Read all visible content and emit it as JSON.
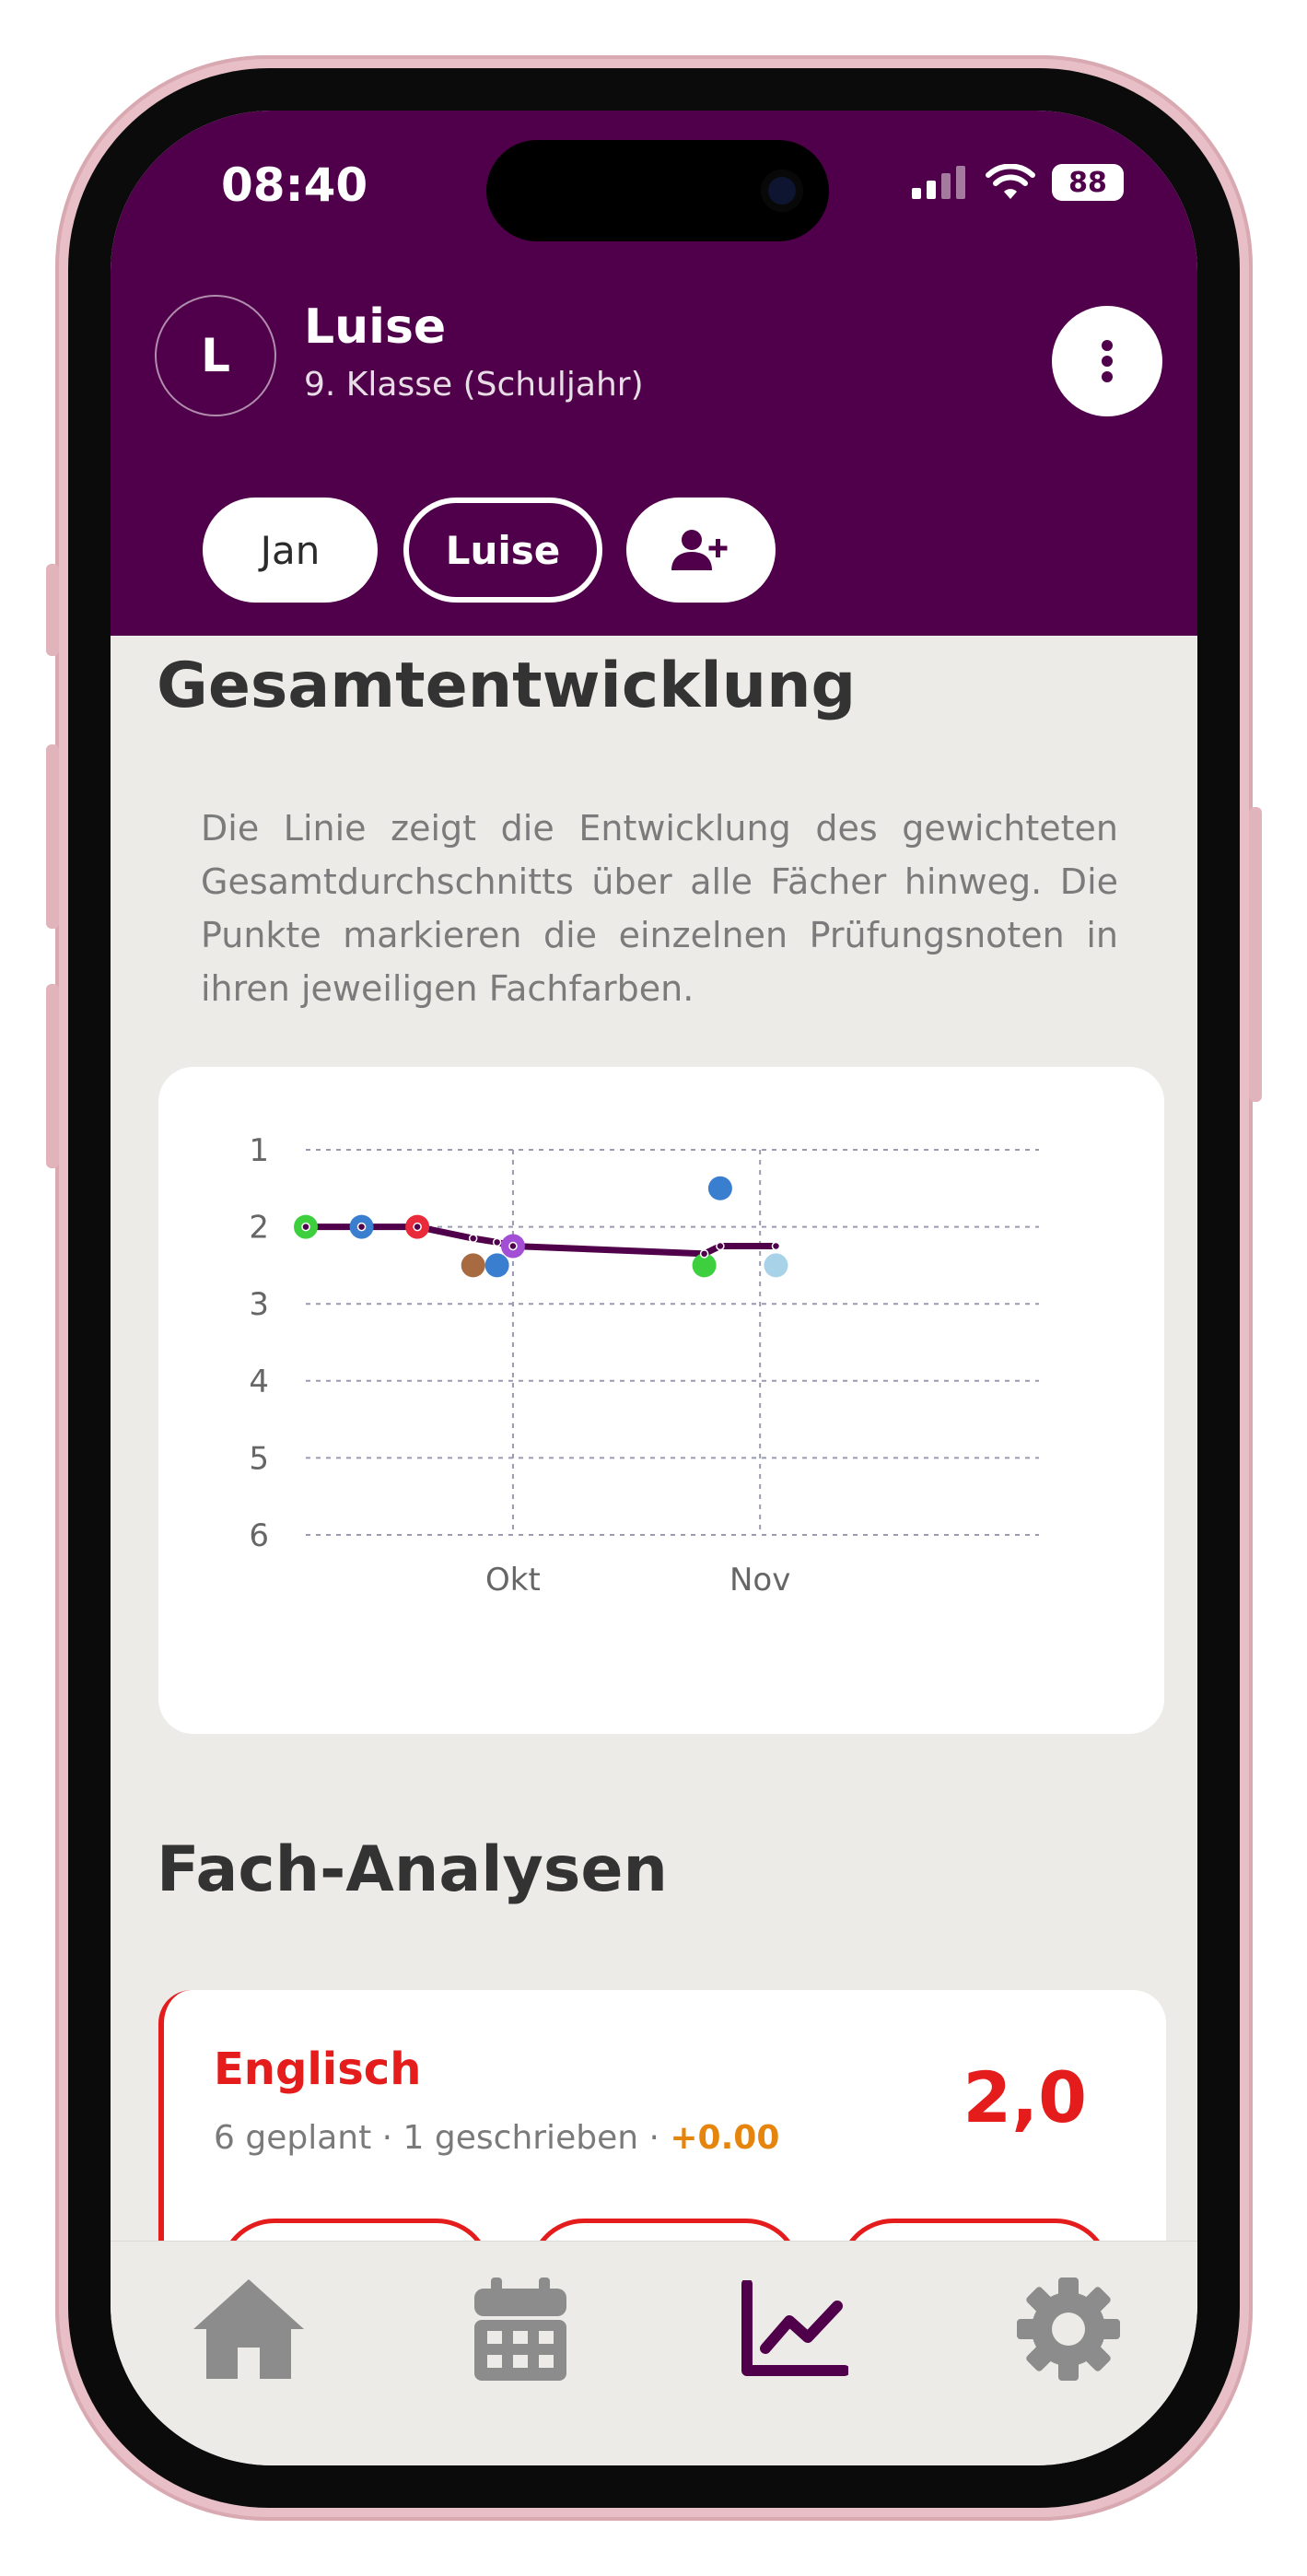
{
  "status_bar": {
    "time": "08:40",
    "battery": "88"
  },
  "profile": {
    "initial": "L",
    "name": "Luise",
    "class_label": "9. Klasse (Schuljahr)"
  },
  "students": [
    {
      "label": "Jan",
      "selected": false
    },
    {
      "label": "Luise",
      "selected": true
    }
  ],
  "overview": {
    "title": "Gesamtentwicklung",
    "description": "Die Linie zeigt die Entwicklung des gewichteten Gesamtdurchschnitts über alle Fächer hinweg. Die Punkte markieren die einzelnen Prüfungsnoten in ihren jeweiligen Fachfarben."
  },
  "chart_data": {
    "type": "line",
    "y_ticks": [
      "1",
      "2",
      "3",
      "4",
      "5",
      "6"
    ],
    "ylim": [
      1,
      6
    ],
    "y_inverted": true,
    "x_ticks": [
      "Okt",
      "Nov"
    ],
    "grid": true,
    "average_line": {
      "color": "#50004a",
      "points": [
        {
          "x": "2024-09-05",
          "y": 2.0
        },
        {
          "x": "2024-09-12",
          "y": 2.0
        },
        {
          "x": "2024-09-19",
          "y": 2.0
        },
        {
          "x": "2024-09-26",
          "y": 2.15
        },
        {
          "x": "2024-09-29",
          "y": 2.2
        },
        {
          "x": "2024-10-01",
          "y": 2.25
        },
        {
          "x": "2024-10-25",
          "y": 2.35
        },
        {
          "x": "2024-10-27",
          "y": 2.25
        },
        {
          "x": "2024-11-03",
          "y": 2.25
        }
      ]
    },
    "grade_points": [
      {
        "x": "2024-09-05",
        "y": 2.0,
        "color": "#3ecf3e"
      },
      {
        "x": "2024-09-12",
        "y": 2.0,
        "color": "#3a7ed0"
      },
      {
        "x": "2024-09-19",
        "y": 2.0,
        "color": "#e82a3a"
      },
      {
        "x": "2024-09-26",
        "y": 2.5,
        "color": "#a86a40"
      },
      {
        "x": "2024-09-29",
        "y": 2.5,
        "color": "#3a7ed0"
      },
      {
        "x": "2024-10-01",
        "y": 2.25,
        "color": "#a24fd6"
      },
      {
        "x": "2024-10-25",
        "y": 2.5,
        "color": "#3ecf3e"
      },
      {
        "x": "2024-10-27",
        "y": 1.5,
        "color": "#3a7ed0"
      },
      {
        "x": "2024-11-03",
        "y": 2.5,
        "color": "#a8d2e8"
      }
    ]
  },
  "analyses": {
    "title": "Fach-Analysen",
    "subjects": [
      {
        "name": "Englisch",
        "planned": "6 geplant",
        "written": "1 geschrieben",
        "separator": " · ",
        "trend": "+0.00",
        "grade": "2,0",
        "color": "#e51c1c"
      }
    ]
  },
  "nav": {
    "items": [
      {
        "icon": "home-icon",
        "active": false
      },
      {
        "icon": "calendar-icon",
        "active": false
      },
      {
        "icon": "chart-icon",
        "active": true
      },
      {
        "icon": "gear-icon",
        "active": false
      }
    ],
    "inactive_color": "#8c8c8c",
    "active_color": "#50004a"
  }
}
